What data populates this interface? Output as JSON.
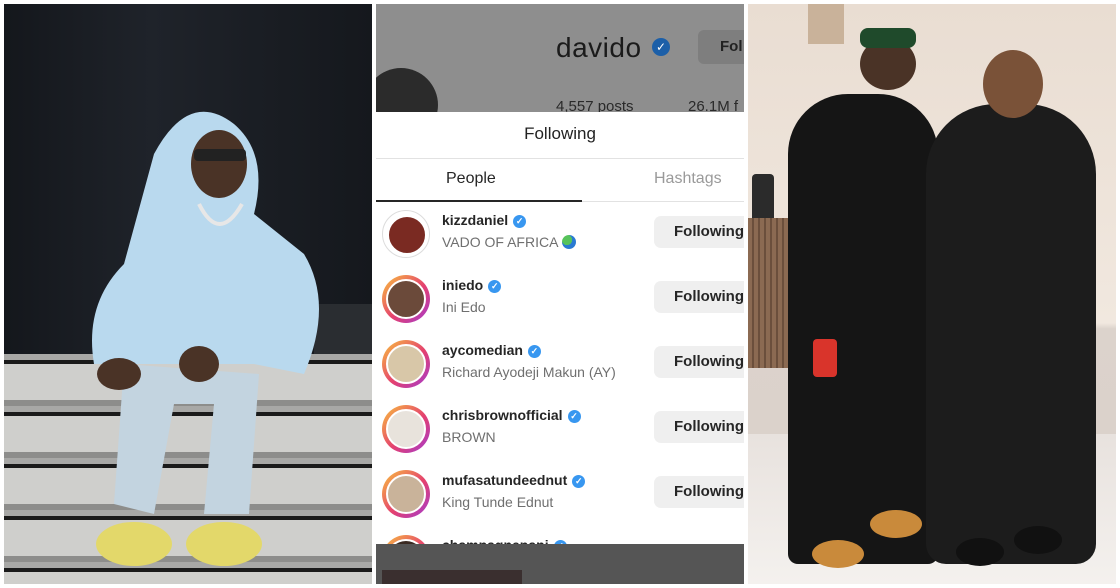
{
  "profile": {
    "username": "davido",
    "follow_button": "Fol",
    "posts": "4,557 posts",
    "followers": "26.1M f"
  },
  "sheet": {
    "title": "Following",
    "tabs": [
      "People",
      "Hashtags"
    ]
  },
  "following": [
    {
      "username": "kizzdaniel",
      "name": "VADO OF AFRICA",
      "verified": true,
      "button": "Following",
      "story_ring": false,
      "emoji": "globe-emoji"
    },
    {
      "username": "iniedo",
      "name": "Ini Edo",
      "verified": true,
      "button": "Following",
      "story_ring": true
    },
    {
      "username": "aycomedian",
      "name": "Richard Ayodeji Makun (AY)",
      "verified": true,
      "button": "Following",
      "story_ring": true
    },
    {
      "username": "chrisbrownofficial",
      "name": "BROWN",
      "verified": true,
      "button": "Following",
      "story_ring": true
    },
    {
      "username": "mufasatundeednut",
      "name": "King Tunde Ednut",
      "verified": true,
      "button": "Following",
      "story_ring": true
    },
    {
      "username": "champagnepapi",
      "name": "",
      "verified": true,
      "button": "",
      "story_ring": true
    }
  ],
  "colors": {
    "verified_badge": "#3897f0",
    "button_bg": "#efefef",
    "story_ring": "#e4406f",
    "dimmed_header": "#8e8e8e"
  }
}
